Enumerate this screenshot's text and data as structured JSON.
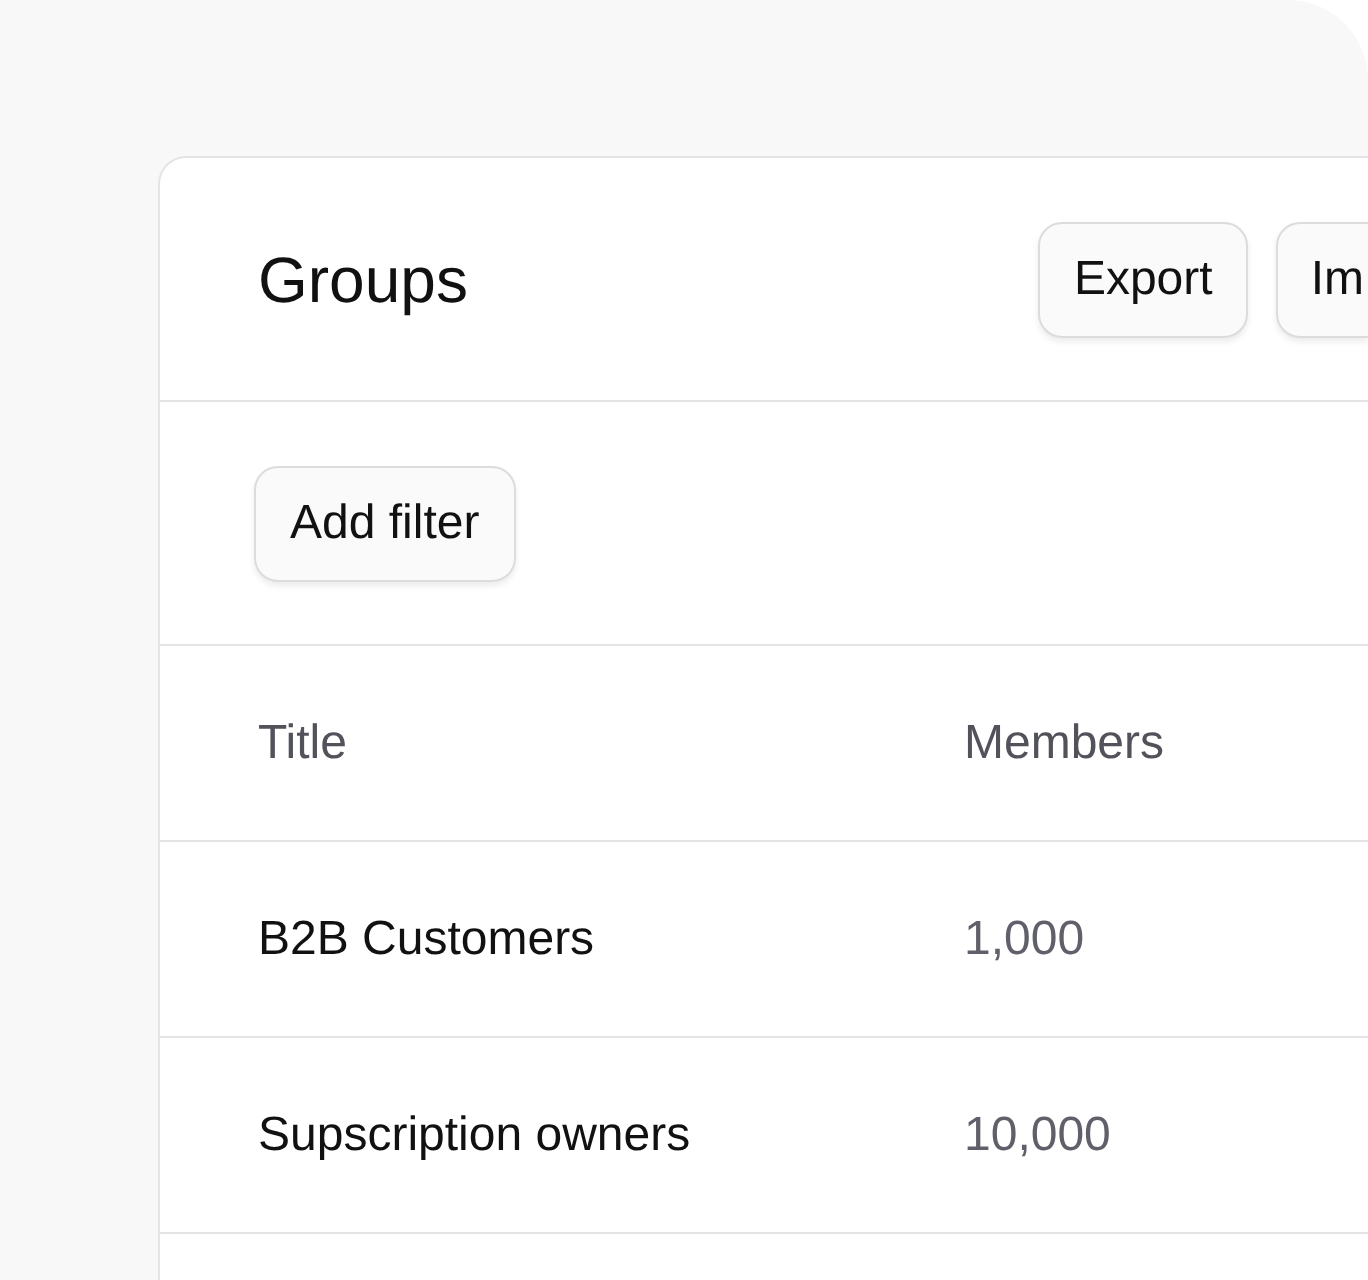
{
  "header": {
    "title": "Groups",
    "actions": [
      "Export",
      "Im"
    ]
  },
  "filters": {
    "add_button": "Add filter"
  },
  "table": {
    "columns": [
      "Title",
      "Members"
    ],
    "rows": [
      [
        "B2B Customers",
        "1,000"
      ],
      [
        "Supscription owners",
        "10,000"
      ]
    ]
  }
}
